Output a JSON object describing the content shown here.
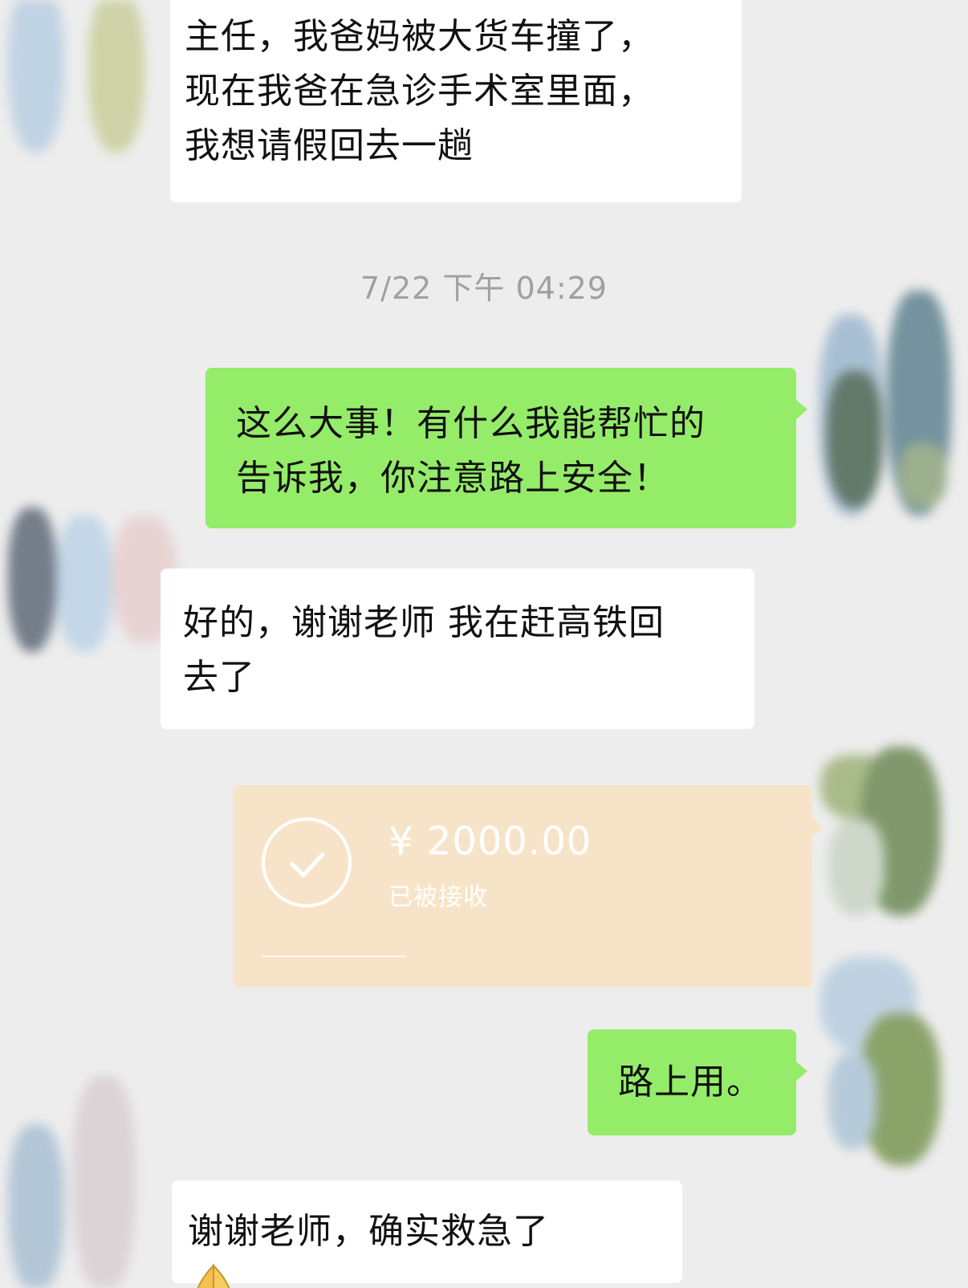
{
  "chat": {
    "messages": [
      {
        "id": "m1",
        "sender": "other",
        "text": "主任，我爸妈被大货车撞了，\n现在我爸在急诊手术室里面，\n我想请假回去一趟"
      },
      {
        "id": "m2",
        "sender": "self",
        "text": "这么大事！有什么我能帮忙的\n告诉我，你注意路上安全！"
      },
      {
        "id": "m3",
        "sender": "other",
        "text": "好的，谢谢老师 我在赶高铁回\n去了"
      },
      {
        "id": "m5",
        "sender": "self",
        "text": "路上用。"
      },
      {
        "id": "m6",
        "sender": "other",
        "text": "谢谢老师，确实救急了",
        "emoji": "folded-hands-icon"
      }
    ],
    "timestamp": "7/22 下午 04:29",
    "transfer": {
      "amount": "¥ 2000.00",
      "status": "已被接收",
      "icon": "check-circle-icon"
    }
  },
  "colors": {
    "background": "#ededed",
    "self_bubble": "#95ec69",
    "other_bubble": "#ffffff",
    "transfer_card": "#f7e4c8",
    "timestamp_text": "#a0a0a0"
  }
}
